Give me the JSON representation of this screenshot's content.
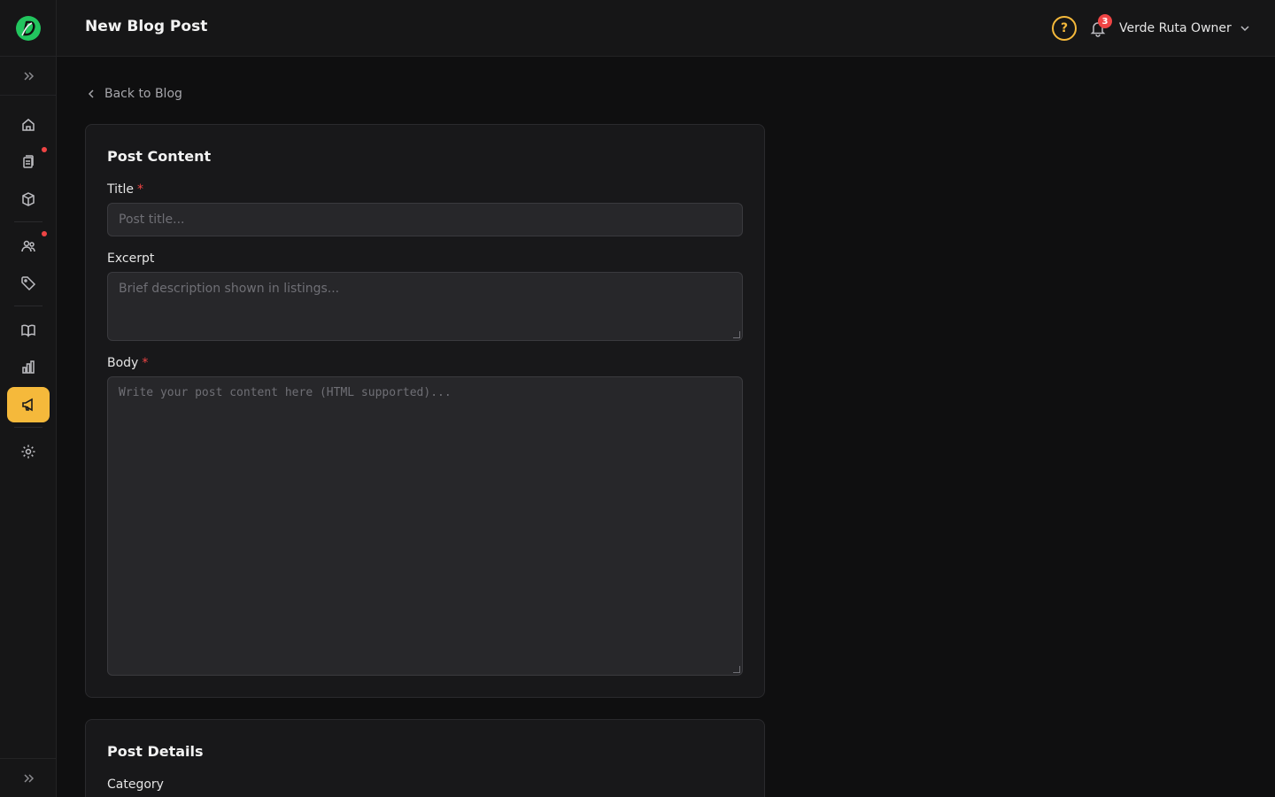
{
  "header": {
    "title": "New Blog Post",
    "help_symbol": "?",
    "notifications_count": "3",
    "user_name": "Verde Ruta Owner"
  },
  "sidebar": {
    "items": [
      {
        "name": "home",
        "icon": "home-icon",
        "active": false,
        "has_dot": false
      },
      {
        "name": "orders",
        "icon": "clipboard-icon",
        "active": false,
        "has_dot": true
      },
      {
        "name": "products",
        "icon": "cube-icon",
        "active": false,
        "has_dot": false
      },
      {
        "name": "customers",
        "icon": "users-icon",
        "active": false,
        "has_dot": true
      },
      {
        "name": "tags",
        "icon": "tag-icon",
        "active": false,
        "has_dot": false
      },
      {
        "name": "catalog",
        "icon": "book-icon",
        "active": false,
        "has_dot": false
      },
      {
        "name": "analytics",
        "icon": "bar-chart-icon",
        "active": false,
        "has_dot": false
      },
      {
        "name": "marketing",
        "icon": "megaphone-icon",
        "active": true,
        "has_dot": false
      },
      {
        "name": "settings",
        "icon": "gear-icon",
        "active": false,
        "has_dot": false
      }
    ]
  },
  "main": {
    "back_label": "Back to Blog",
    "content_card": {
      "title": "Post Content",
      "title_label": "Title",
      "title_placeholder": "Post title...",
      "excerpt_label": "Excerpt",
      "excerpt_placeholder": "Brief description shown in listings...",
      "body_label": "Body",
      "body_placeholder": "Write your post content here (HTML supported)...",
      "required_mark": "*"
    },
    "details_card": {
      "title": "Post Details",
      "category_label": "Category"
    }
  },
  "colors": {
    "accent": "#f5b93b",
    "danger": "#ef4444",
    "background": "#0f0f10",
    "surface": "#18181a"
  }
}
